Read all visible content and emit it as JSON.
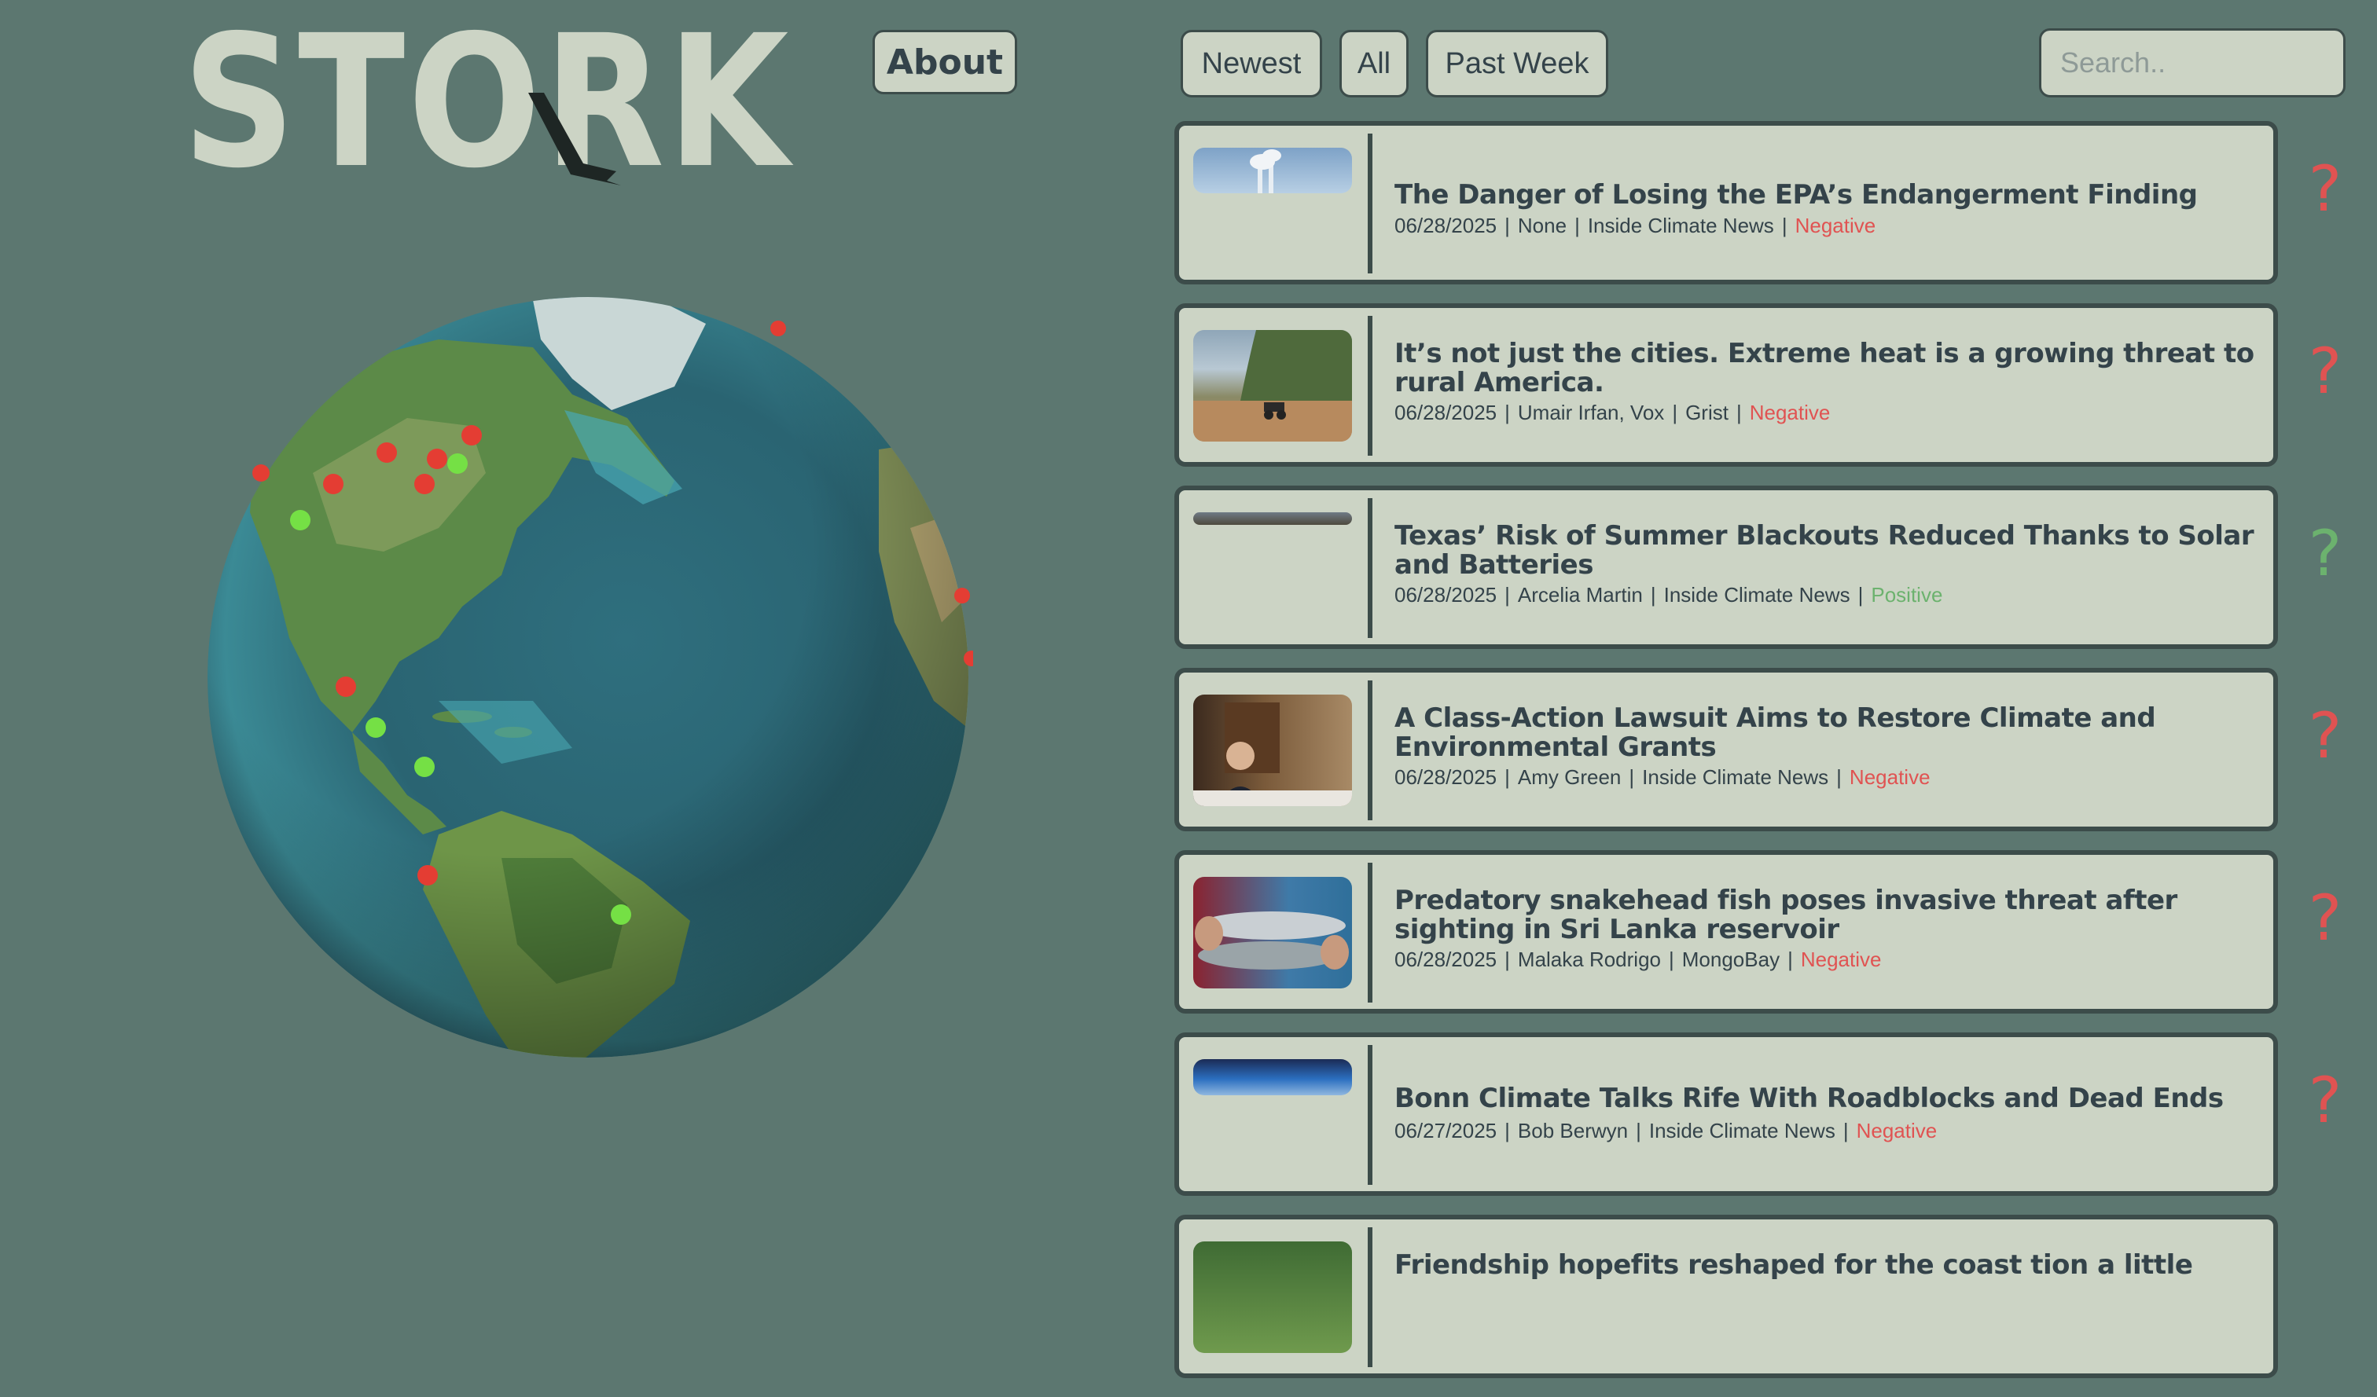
{
  "app": {
    "logo_text": "STORK"
  },
  "header": {
    "about_label": "About"
  },
  "filters": [
    {
      "label": "Newest"
    },
    {
      "label": "All"
    },
    {
      "label": "Past Week"
    }
  ],
  "search": {
    "placeholder": "Search.."
  },
  "colors": {
    "background": "#5c7770",
    "card": "#ccd4c5",
    "text": "#34434a",
    "negative": "#e05352",
    "positive": "#6cb26e"
  },
  "globe": {
    "icon": "earth-globe",
    "markers": [
      {
        "sentiment": "Negative"
      },
      {
        "sentiment": "Negative"
      },
      {
        "sentiment": "Negative"
      },
      {
        "sentiment": "Negative"
      },
      {
        "sentiment": "Negative"
      },
      {
        "sentiment": "Negative"
      },
      {
        "sentiment": "Negative"
      },
      {
        "sentiment": "Positive"
      },
      {
        "sentiment": "Positive"
      },
      {
        "sentiment": "Negative"
      },
      {
        "sentiment": "Negative"
      },
      {
        "sentiment": "Negative"
      },
      {
        "sentiment": "Positive"
      },
      {
        "sentiment": "Positive"
      },
      {
        "sentiment": "Negative"
      },
      {
        "sentiment": "Positive"
      }
    ]
  },
  "articles": [
    {
      "title": "The Danger of Losing the EPA’s Endangerment Finding",
      "date": "06/28/2025",
      "author": "None",
      "source": "Inside Climate News",
      "sentiment": "Negative",
      "thumb": "smokestack"
    },
    {
      "title": "It’s not just the cities. Extreme heat is a growing threat to rural America.",
      "date": "06/28/2025",
      "author": "Umair Irfan, Vox",
      "source": "Grist",
      "sentiment": "Negative",
      "thumb": "tractor-field"
    },
    {
      "title": "Texas’ Risk of Summer Blackouts Reduced Thanks to Solar and Batteries",
      "date": "06/28/2025",
      "author": "Arcelia Martin",
      "source": "Inside Climate News",
      "sentiment": "Positive",
      "thumb": "solar-field"
    },
    {
      "title": "A Class-Action Lawsuit Aims to Restore Climate and Environmental Grants",
      "date": "06/28/2025",
      "author": "Amy Green",
      "source": "Inside Climate News",
      "sentiment": "Negative",
      "thumb": "hearing-room"
    },
    {
      "title": "Predatory snakehead fish poses invasive threat after sighting in Sri Lanka reservoir",
      "date": "06/28/2025",
      "author": "Malaka Rodrigo",
      "source": "MongoBay",
      "sentiment": "Negative",
      "thumb": "fish-in-hands"
    },
    {
      "title": "Bonn Climate Talks Rife With Roadblocks and Dead Ends",
      "date": "06/27/2025",
      "author": "Bob Berwyn",
      "source": "Inside Climate News",
      "sentiment": "Negative",
      "thumb": "conference-banner"
    },
    {
      "title": "Friendship hopefits reshaped for the coast tion a little",
      "date": "",
      "author": "",
      "source": "",
      "sentiment": "",
      "thumb": "forest"
    }
  ],
  "feedback": {
    "mark": "?"
  }
}
